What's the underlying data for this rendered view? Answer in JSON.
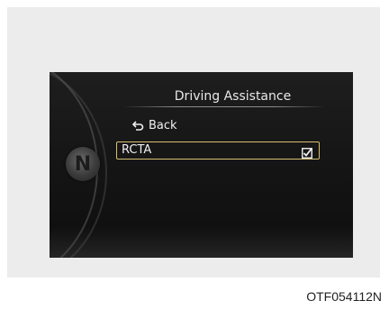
{
  "menu": {
    "title": "Driving Assistance",
    "back_label": "Back",
    "items": [
      {
        "label": "RCTA",
        "checked": true,
        "selected": true
      }
    ]
  },
  "badge": {
    "letter": "N"
  },
  "caption": "OTF054112N",
  "colors": {
    "highlight_border": "#d9c070",
    "screen_bg": "#141414",
    "text": "#f0f0f0",
    "panel_bg": "#ececec"
  },
  "icons": {
    "back": "return-arrow-icon",
    "check": "checkbox-checked-icon"
  }
}
